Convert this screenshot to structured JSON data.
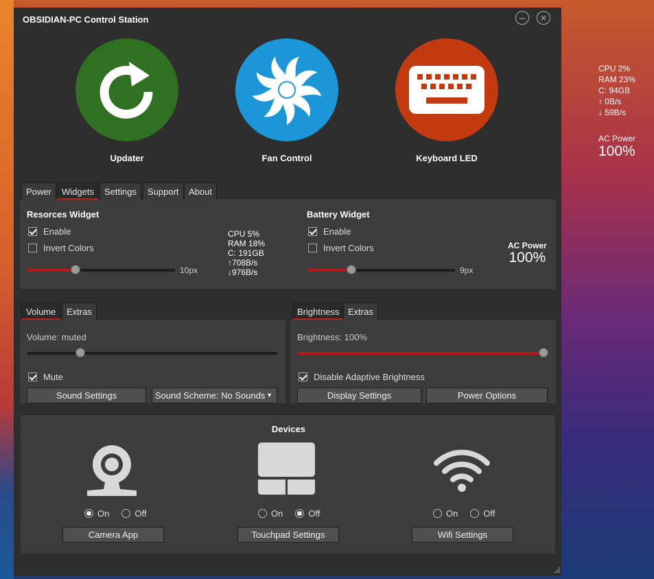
{
  "overlay": {
    "cpu": "CPU 2%",
    "ram": "RAM 23%",
    "disk": "C: 94GB",
    "up": "↑ 0B/s",
    "down": "↓ 59B/s",
    "ac_label": "AC Power",
    "ac_value": "100%"
  },
  "window": {
    "title": "OBSIDIAN-PC Control Station",
    "minimize_icon": "minus-icon",
    "close_icon": "close-icon"
  },
  "big_buttons": {
    "updater": {
      "label": "Updater",
      "color": "#2f7022",
      "icon": "refresh-icon"
    },
    "fan": {
      "label": "Fan Control",
      "color": "#1c96d6",
      "icon": "fan-icon"
    },
    "keyboard": {
      "label": "Keyboard LED",
      "color": "#c23a10",
      "icon": "keyboard-icon"
    }
  },
  "main_tabs": [
    "Power",
    "Widgets",
    "Settings",
    "Support",
    "About"
  ],
  "main_tab_active": "Widgets",
  "resources_widget": {
    "title": "Resorces Widget",
    "enable_label": "Enable",
    "enable_checked": true,
    "invert_label": "Invert Colors",
    "invert_checked": false,
    "slider_fraction": 0.3,
    "slider_value": "10px",
    "preview": {
      "cpu": "CPU 5%",
      "ram": "RAM 18%",
      "disk": "C: 191GB",
      "up": "↑708B/s",
      "down": "↓976B/s"
    }
  },
  "battery_widget": {
    "title": "Battery Widget",
    "enable_label": "Enable",
    "enable_checked": true,
    "invert_label": "Invert Colors",
    "invert_checked": false,
    "slider_fraction": 0.3,
    "slider_value": "9px",
    "preview": {
      "ac_label": "AC Power",
      "ac_value": "100%"
    }
  },
  "volume_tabs": [
    "Volume",
    "Extras"
  ],
  "volume": {
    "label": "Volume: muted",
    "slider_fraction": 0.2,
    "mute_label": "Mute",
    "mute_checked": true,
    "sound_settings": "Sound Settings",
    "sound_scheme": "Sound Scheme: No Sounds"
  },
  "brightness_tabs": [
    "Brightness",
    "Extras"
  ],
  "brightness": {
    "label": "Brightness: 100%",
    "slider_fraction": 1.0,
    "adaptive_label": "Disable Adaptive Brightness",
    "adaptive_checked": true,
    "display_settings": "Display Settings",
    "power_options": "Power Options"
  },
  "devices": {
    "title": "Devices",
    "on_label": "On",
    "off_label": "Off",
    "camera": {
      "state": "on",
      "button": "Camera App",
      "icon": "webcam-icon"
    },
    "touchpad": {
      "state": "off",
      "button": "Touchpad Settings",
      "icon": "touchpad-icon"
    },
    "wifi": {
      "state": "off",
      "button": "Wifi Settings",
      "icon": "wifi-icon"
    }
  },
  "colors": {
    "accent": "#c01c1c",
    "window_bg": "#2e2e2e",
    "panel_bg": "#3c3c3c"
  }
}
